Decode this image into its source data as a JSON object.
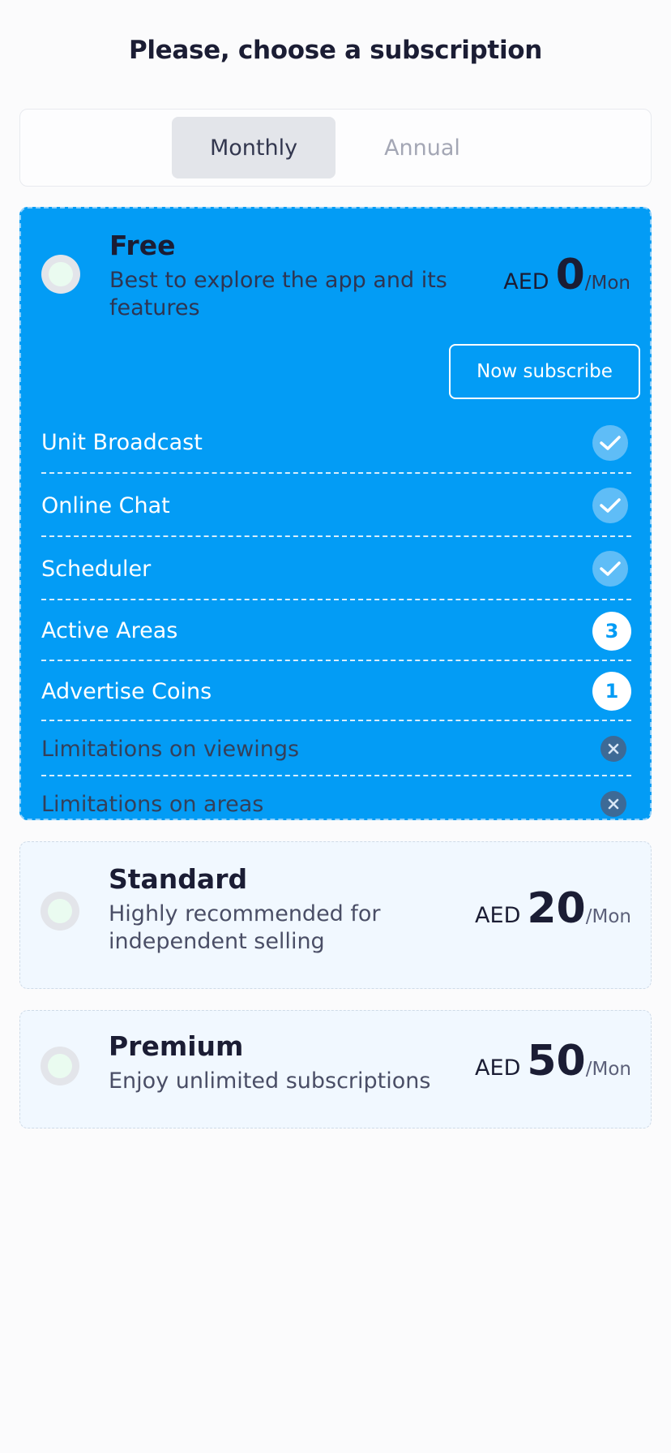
{
  "title": "Please, choose a subscription",
  "billing_toggle": {
    "monthly_label": "Monthly",
    "annual_label": "Annual",
    "selected": "Monthly"
  },
  "plans": [
    {
      "name": "Free",
      "description": "Best to explore the app and its features",
      "currency": "AED",
      "amount": "0",
      "period": "/Mon",
      "selected": true,
      "subscribe_label": "Now subscribe",
      "features": [
        {
          "label": "Unit Broadcast",
          "status": "check"
        },
        {
          "label": "Online Chat",
          "status": "check"
        },
        {
          "label": "Scheduler",
          "status": "check"
        },
        {
          "label": "Active Areas",
          "count": "3"
        },
        {
          "label": "Advertise Coins",
          "count": "1"
        },
        {
          "label": "Limitations on viewings",
          "status": "x"
        },
        {
          "label": "Limitations on areas",
          "status": "x"
        }
      ]
    },
    {
      "name": "Standard",
      "description": "Highly recommended for independent selling",
      "currency": "AED",
      "amount": "20",
      "period": "/Mon",
      "selected": false
    },
    {
      "name": "Premium",
      "description": "Enjoy unlimited subscriptions",
      "currency": "AED",
      "amount": "50",
      "period": "/Mon",
      "selected": false
    }
  ],
  "colors": {
    "selected_card": "#039cf5",
    "unselected_card": "#f1f8ff",
    "page_background": "#fbfbfc",
    "text_dark": "#1b1d34"
  }
}
